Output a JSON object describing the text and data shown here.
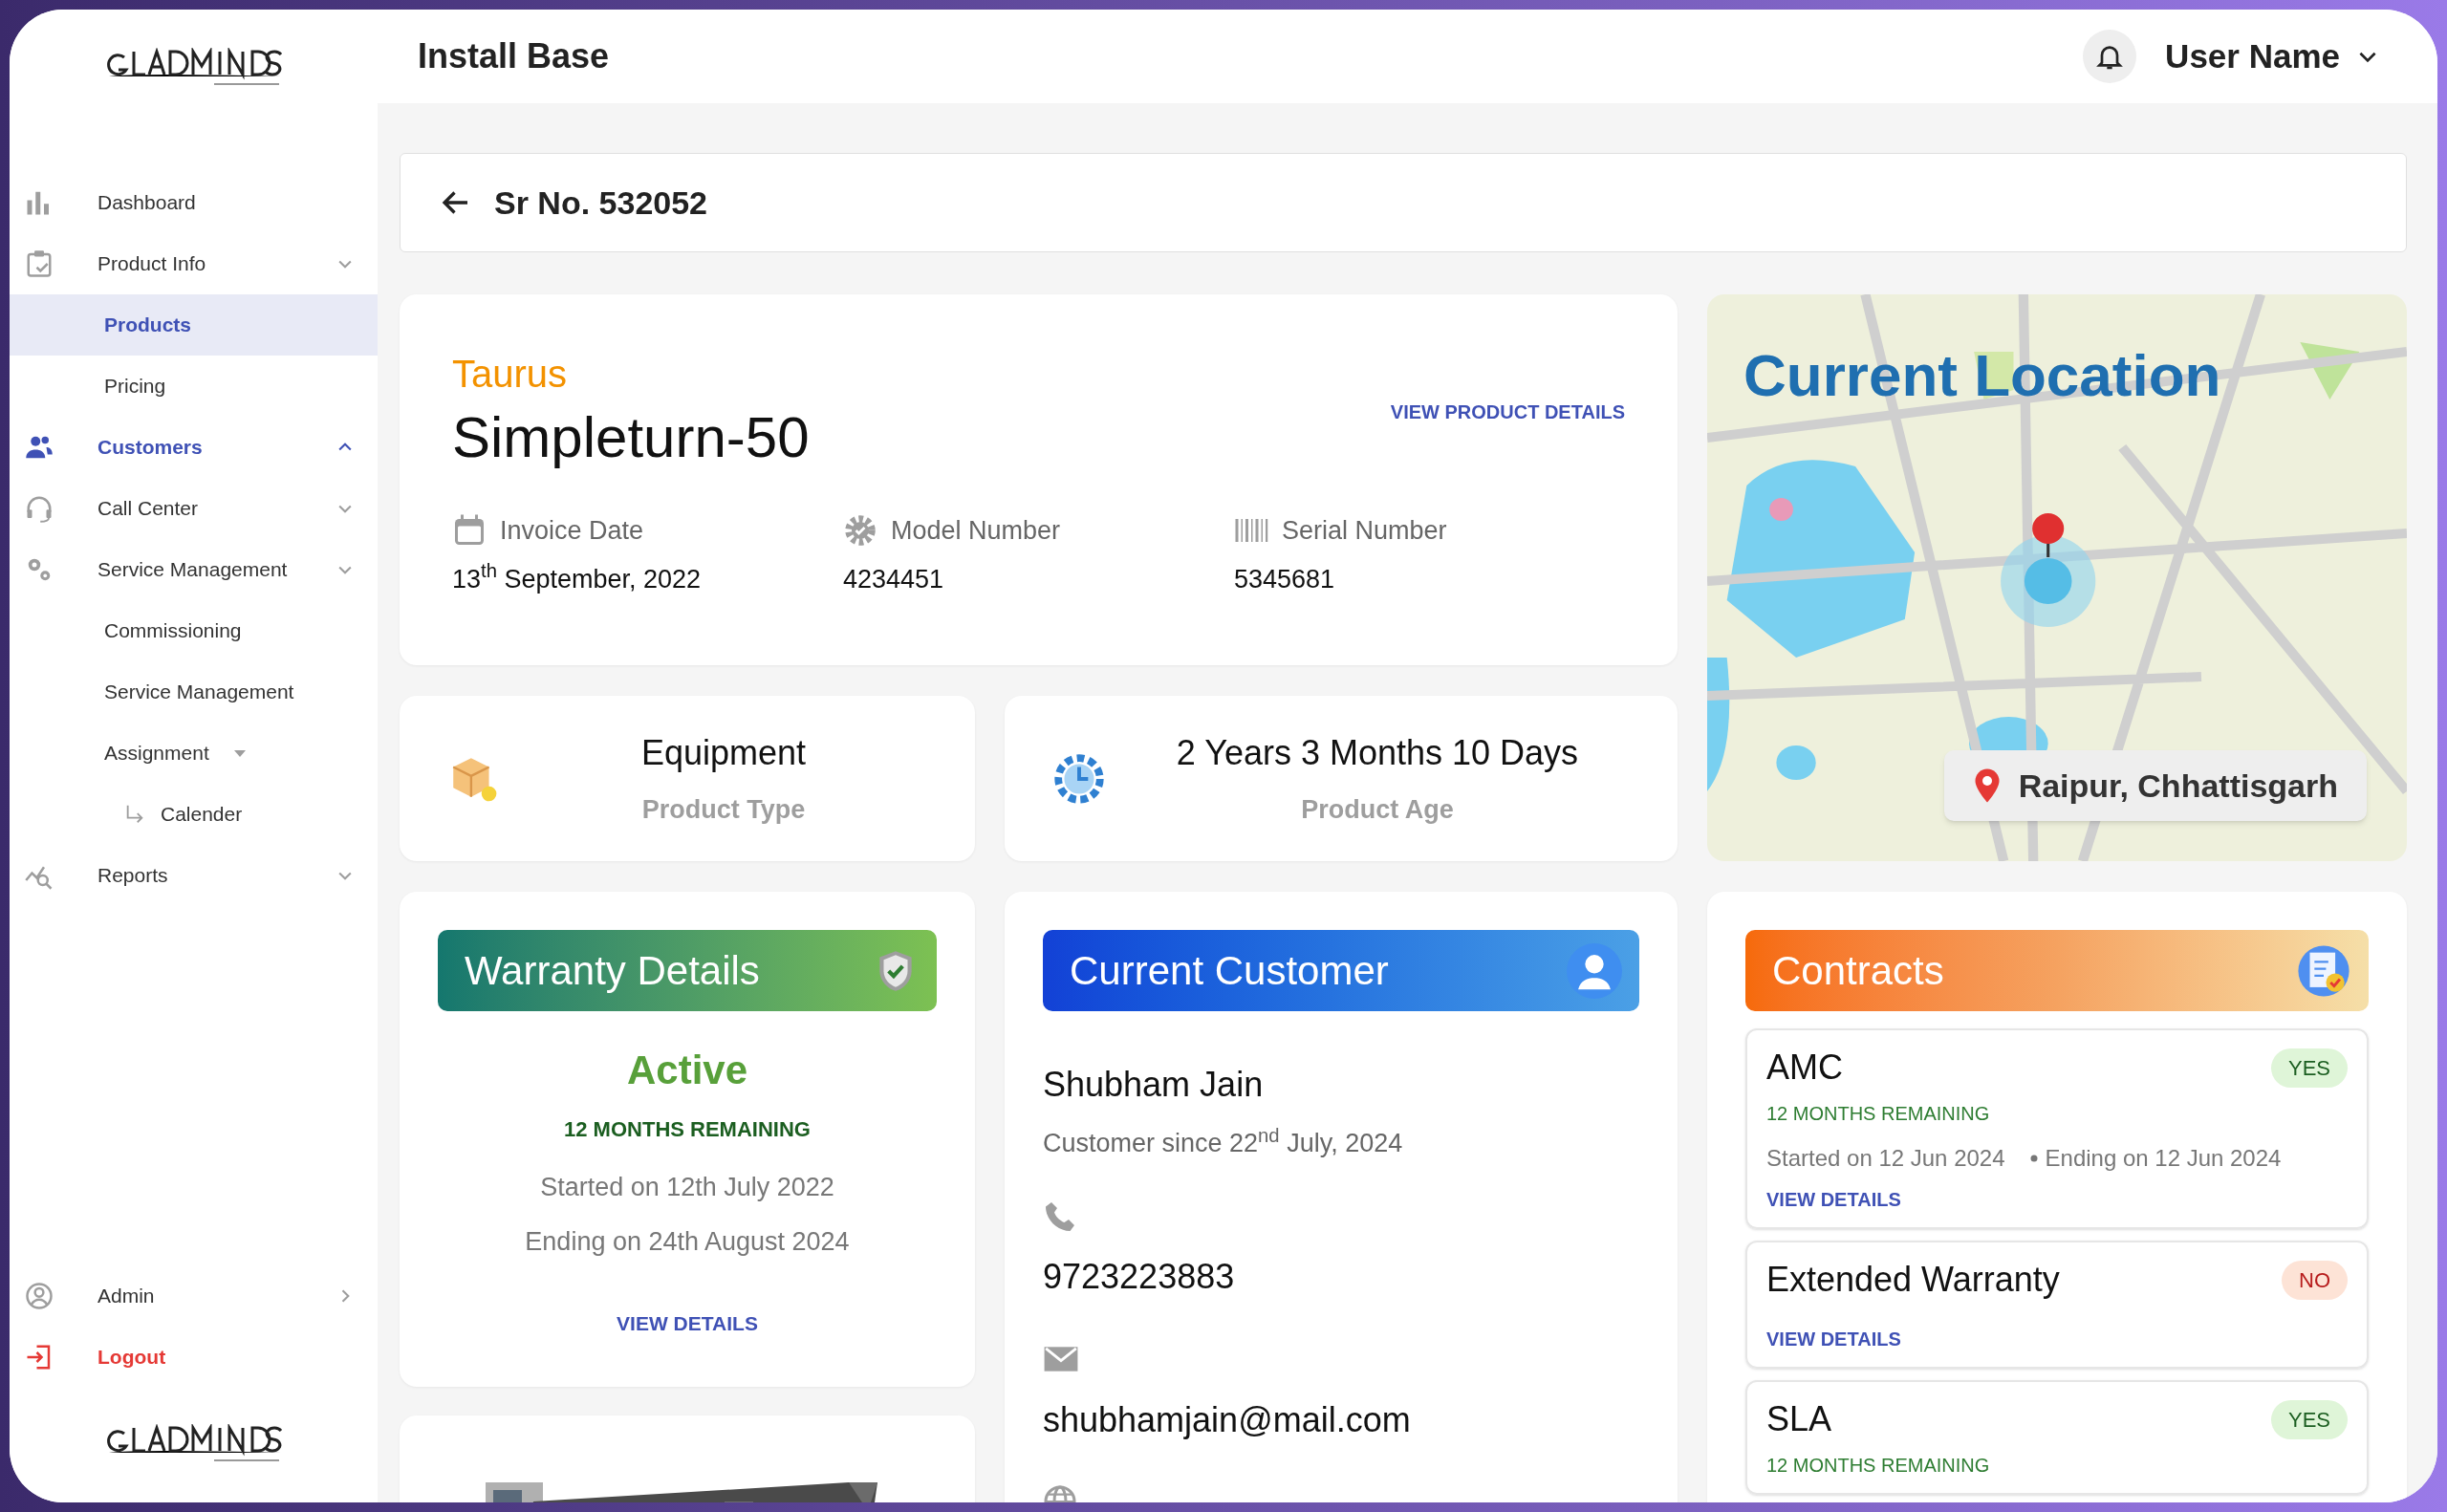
{
  "header": {
    "title": "Install Base",
    "user_name": "User Name"
  },
  "sidebar": {
    "items": [
      {
        "label": "Dashboard",
        "selected": false
      },
      {
        "label": "Product Info",
        "selected": false,
        "expanded": false,
        "children": [
          {
            "label": "Products",
            "selected": true
          },
          {
            "label": "Pricing",
            "selected": false
          }
        ]
      },
      {
        "label": "Customers",
        "selected": true,
        "expanded": true
      },
      {
        "label": "Call Center",
        "selected": false,
        "expanded": false
      },
      {
        "label": "Service Management",
        "selected": false,
        "expanded": false,
        "children": [
          {
            "label": "Commissioning",
            "selected": false
          },
          {
            "label": "Service Management",
            "selected": false
          },
          {
            "label": "Assignment",
            "selected": false,
            "children": [
              {
                "label": "Calender",
                "selected": false
              }
            ]
          }
        ]
      },
      {
        "label": "Reports",
        "selected": false,
        "expanded": false
      }
    ],
    "bottom_items": [
      {
        "label": "Admin",
        "kind": "link",
        "selected": false
      },
      {
        "label": "Logout",
        "kind": "logout",
        "selected": false
      }
    ]
  },
  "serial": {
    "title": "Sr No. 532052"
  },
  "product": {
    "brand": "Taurus",
    "name": "Simpleturn-50",
    "link": "VIEW PRODUCT DETAILS",
    "fields": [
      {
        "label": "Invoice Date",
        "value": "13$^{th}$ September, 2022"
      },
      {
        "label": "Model Number",
        "value": "4234451"
      },
      {
        "label": "Serial Number",
        "value": "5345681"
      }
    ]
  },
  "stats": [
    {
      "value": "Equipment",
      "label": "Product Type"
    },
    {
      "value": "2 Years 3 Months 10 Days",
      "label": "Product Age"
    }
  ],
  "location": {
    "title": "Current Location",
    "place": "Raipur, Chhattisgarh"
  },
  "warranty": {
    "title": "Warranty Details",
    "status": "Active",
    "remaining": "12 MONTHS REMAINING",
    "started": "Started on 12th July 2022",
    "ending": "Ending on 24th August 2024",
    "link": "VIEW DETAILS"
  },
  "customer": {
    "title": "Current Customer",
    "name": "Shubham Jain",
    "since": "Customer since 22$^{nd}$ July, 2024",
    "phone": "9723223883",
    "email": "shubhamjain@mail.com"
  },
  "contracts": {
    "title": "Contracts",
    "items": [
      {
        "name": "AMC",
        "active": true,
        "badge": "YES",
        "remaining": "12 MONTHS REMAINING",
        "started": "Started on 12 Jun 2024",
        "ending": "Ending on 12 Jun 2024",
        "link": "VIEW DETAILS"
      },
      {
        "name": "Extended Warranty",
        "active": false,
        "badge": "NO",
        "link": "VIEW DETAILS"
      },
      {
        "name": "SLA",
        "active": true,
        "badge": "YES",
        "remaining": "12 MONTHS REMAINING"
      }
    ]
  }
}
